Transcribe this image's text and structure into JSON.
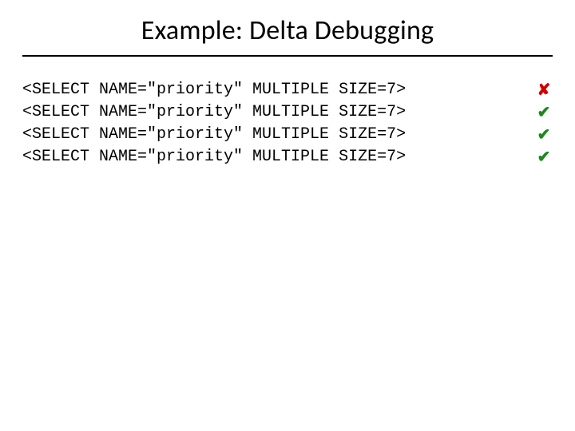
{
  "title": "Example: Delta Debugging",
  "rows": [
    {
      "code": "<SELECT NAME=\"priority\" MULTIPLE SIZE=7>",
      "mark": "✘",
      "status": "fail"
    },
    {
      "code": "<SELECT NAME=\"priority\" MULTIPLE SIZE=7>",
      "mark": "✔",
      "status": "pass"
    },
    {
      "code": "<SELECT NAME=\"priority\" MULTIPLE SIZE=7>",
      "mark": "✔",
      "status": "pass"
    },
    {
      "code": "<SELECT NAME=\"priority\" MULTIPLE SIZE=7>",
      "mark": "✔",
      "status": "pass"
    }
  ]
}
